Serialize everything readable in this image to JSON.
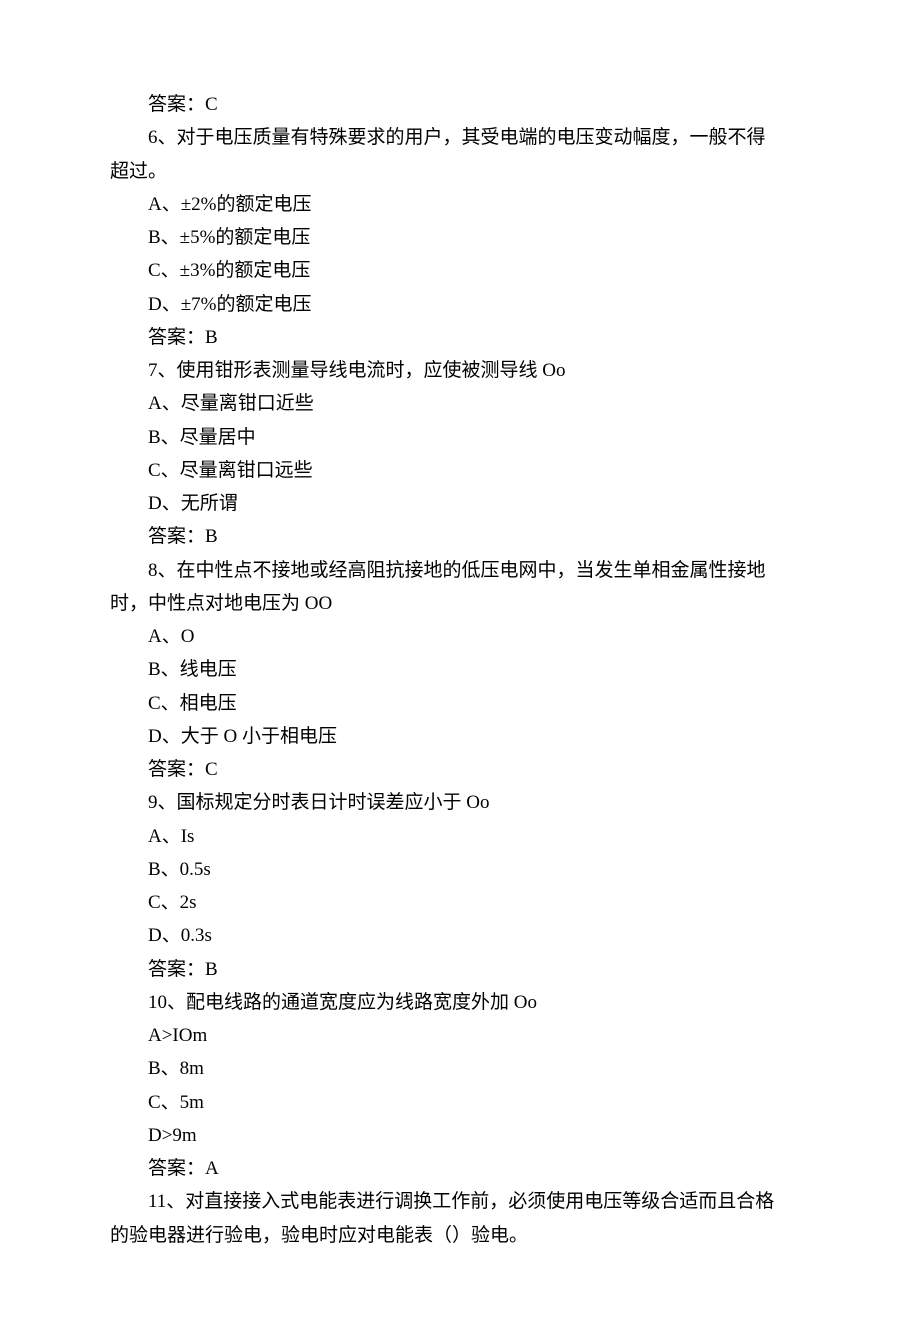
{
  "answer5": "答案：C",
  "q6": {
    "stem_p1": "6、对于电压质量有特殊要求的用户，其受电端的电压变动幅度，一般不得",
    "stem_p2": "超过。",
    "optA": "A、±2%的额定电压",
    "optB": "B、±5%的额定电压",
    "optC": "C、±3%的额定电压",
    "optD": "D、±7%的额定电压",
    "answer": "答案：B"
  },
  "q7": {
    "stem": "7、使用钳形表测量导线电流时，应使被测导线 Oo",
    "optA": "A、尽量离钳口近些",
    "optB": "B、尽量居中",
    "optC": "C、尽量离钳口远些",
    "optD": "D、无所谓",
    "answer": "答案：B"
  },
  "q8": {
    "stem_p1": "8、在中性点不接地或经高阻抗接地的低压电网中，当发生单相金属性接地",
    "stem_p2": "时，中性点对地电压为 OO",
    "optA": "A、O",
    "optB": "B、线电压",
    "optC": "C、相电压",
    "optD": "D、大于 O 小于相电压",
    "answer": "答案：C"
  },
  "q9": {
    "stem": "9、国标规定分时表日计时误差应小于 Oo",
    "optA": "A、Is",
    "optB": "B、0.5s",
    "optC": "C、2s",
    "optD": "D、0.3s",
    "answer": "答案：B"
  },
  "q10": {
    "stem": "10、配电线路的通道宽度应为线路宽度外加 Oo",
    "optA": "A>IOm",
    "optB": "B、8m",
    "optC": "C、5m",
    "optD": "D>9m",
    "answer": "答案：A"
  },
  "q11": {
    "stem_p1": "11、对直接接入式电能表进行调换工作前，必须使用电压等级合适而且合格",
    "stem_p2": "的验电器进行验电，验电时应对电能表（）验电。"
  }
}
